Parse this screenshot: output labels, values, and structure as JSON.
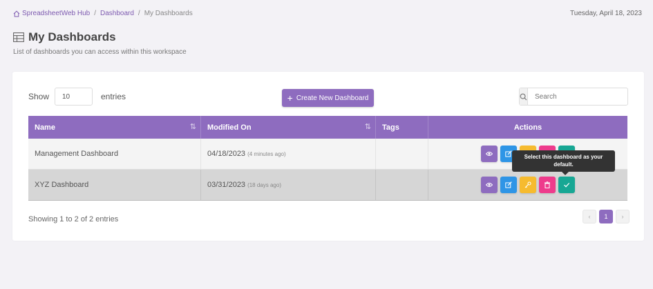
{
  "breadcrumb": {
    "home": "SpreadsheetWeb Hub",
    "sep": "/",
    "dashboard": "Dashboard",
    "current": "My Dashboards"
  },
  "date": "Tuesday, April 18, 2023",
  "header": {
    "title": "My Dashboards",
    "subtitle": "List of dashboards you can access within this workspace"
  },
  "controls": {
    "show_label": "Show",
    "entries_value": "10",
    "entries_label": "entries",
    "create_label": "Create New Dashboard",
    "search_placeholder": "Search"
  },
  "table": {
    "columns": [
      "Name",
      "Modified On",
      "Tags",
      "Actions"
    ],
    "rows": [
      {
        "name": "Management Dashboard",
        "modified": "04/18/2023",
        "ago": "(4 minutes ago)",
        "tags": ""
      },
      {
        "name": "XYZ Dashboard",
        "modified": "03/31/2023",
        "ago": "(18 days ago)",
        "tags": ""
      }
    ]
  },
  "tooltip": "Select this dashboard as your default.",
  "footer": {
    "info": "Showing 1 to 2 of 2 entries",
    "page": "1",
    "prev": "‹",
    "next": "›"
  },
  "colors": {
    "accent": "#8e6cbf",
    "view": "#8e6cbf",
    "edit": "#2e95e6",
    "key": "#f6bb2f",
    "delete": "#ee3b8c",
    "default": "#17a794"
  },
  "icons": {
    "view": "eye-icon",
    "edit": "edit-icon",
    "key": "key-icon",
    "delete": "trash-icon",
    "default": "check-icon"
  }
}
